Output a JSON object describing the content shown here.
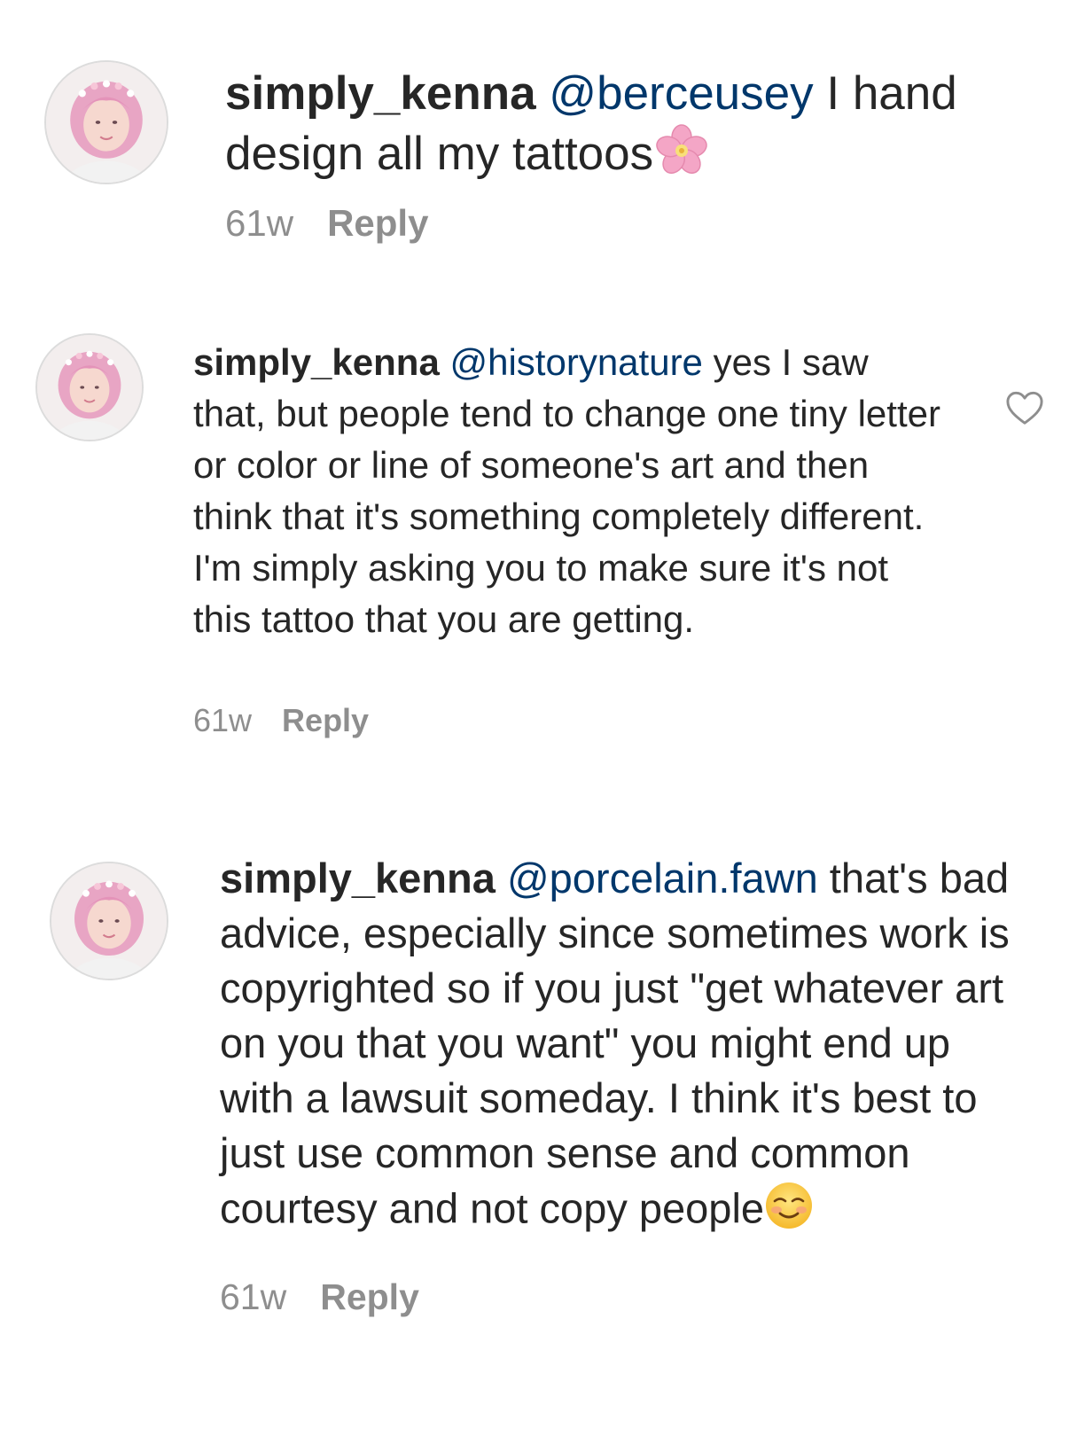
{
  "comments": [
    {
      "username": "simply_kenna",
      "mention": "@berceusey",
      "text": " I hand design all my tattoos",
      "trailing_emoji": "cherry-blossom-emoji",
      "time": "61w",
      "reply_label": "Reply"
    },
    {
      "username": "simply_kenna",
      "mention": "@historynature",
      "text": " yes I saw that, but people tend to change one tiny letter or color or line of someone's art and then think that it's something completely different. I'm simply asking you to make sure it's not this tattoo that you are getting.",
      "time": "61w",
      "reply_label": "Reply",
      "like_icon": "heart-outline-icon"
    },
    {
      "username": "simply_kenna",
      "mention": "@porcelain.fawn",
      "text": " that's bad advice, especially since sometimes work is copyrighted so if you just \"get whatever art on you that you want\" you might end up with a lawsuit someday. I think it's best to just use common sense and common courtesy and not copy people",
      "trailing_emoji": "smiling-face-emoji",
      "time": "61w",
      "reply_label": "Reply"
    }
  ],
  "colors": {
    "text": "#262626",
    "mention": "#00376b",
    "meta": "#8e8e8e"
  }
}
